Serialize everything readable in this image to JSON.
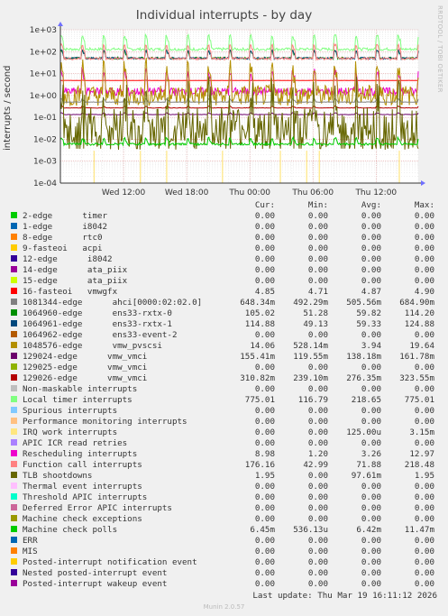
{
  "title": "Individual interrupts - by day",
  "y_axis_label": "interrupts / second",
  "side_label": "RRDTOOL / TOBI OETIKER",
  "footer": {
    "last_update": "Last update: Thu Mar 19 16:11:12 2026",
    "version": "Munin 2.0.57"
  },
  "legend_header": {
    "cur": "Cur:",
    "min": "Min:",
    "avg": "Avg:",
    "max": "Max:"
  },
  "legend": [
    {
      "label": "2-edge      timer",
      "color": "#00cc00",
      "cur": "0.00",
      "min": "0.00",
      "avg": "0.00",
      "max": "0.00"
    },
    {
      "label": "1-edge      i8042",
      "color": "#0066b3",
      "cur": "0.00",
      "min": "0.00",
      "avg": "0.00",
      "max": "0.00"
    },
    {
      "label": "8-edge      rtc0",
      "color": "#ff8000",
      "cur": "0.00",
      "min": "0.00",
      "avg": "0.00",
      "max": "0.00"
    },
    {
      "label": "9-fasteoi   acpi",
      "color": "#ffcc00",
      "cur": "0.00",
      "min": "0.00",
      "avg": "0.00",
      "max": "0.00"
    },
    {
      "label": "12-edge      i8042",
      "color": "#330099",
      "cur": "0.00",
      "min": "0.00",
      "avg": "0.00",
      "max": "0.00"
    },
    {
      "label": "14-edge      ata_piix",
      "color": "#990099",
      "cur": "0.00",
      "min": "0.00",
      "avg": "0.00",
      "max": "0.00"
    },
    {
      "label": "15-edge      ata_piix",
      "color": "#ccff00",
      "cur": "0.00",
      "min": "0.00",
      "avg": "0.00",
      "max": "0.00"
    },
    {
      "label": "16-fasteoi   vmwgfx",
      "color": "#ff0000",
      "cur": "4.85",
      "min": "4.71",
      "avg": "4.87",
      "max": "4.90"
    },
    {
      "label": "1081344-edge      ahci[0000:02:02.0]",
      "color": "#808080",
      "cur": "648.34m",
      "min": "492.29m",
      "avg": "505.56m",
      "max": "684.90m"
    },
    {
      "label": "1064960-edge      ens33-rxtx-0",
      "color": "#008f00",
      "cur": "105.02",
      "min": "51.28",
      "avg": "59.82",
      "max": "114.20"
    },
    {
      "label": "1064961-edge      ens33-rxtx-1",
      "color": "#00487d",
      "cur": "114.88",
      "min": "49.13",
      "avg": "59.33",
      "max": "124.88"
    },
    {
      "label": "1064962-edge      ens33-event-2",
      "color": "#b35a00",
      "cur": "0.00",
      "min": "0.00",
      "avg": "0.00",
      "max": "0.00"
    },
    {
      "label": "1048576-edge      vmw_pvscsi",
      "color": "#b38f00",
      "cur": "14.06",
      "min": "528.14m",
      "avg": "3.94",
      "max": "19.64"
    },
    {
      "label": "129024-edge      vmw_vmci",
      "color": "#6b006b",
      "cur": "155.41m",
      "min": "119.55m",
      "avg": "138.18m",
      "max": "161.78m"
    },
    {
      "label": "129025-edge      vmw_vmci",
      "color": "#8fb300",
      "cur": "0.00",
      "min": "0.00",
      "avg": "0.00",
      "max": "0.00"
    },
    {
      "label": "129026-edge      vmw_vmci",
      "color": "#b30000",
      "cur": "310.82m",
      "min": "239.10m",
      "avg": "276.35m",
      "max": "323.55m"
    },
    {
      "label": "Non-maskable interrupts",
      "color": "#bebebe",
      "cur": "0.00",
      "min": "0.00",
      "avg": "0.00",
      "max": "0.00"
    },
    {
      "label": "Local timer interrupts",
      "color": "#80ff80",
      "cur": "775.01",
      "min": "116.79",
      "avg": "218.65",
      "max": "775.01"
    },
    {
      "label": "Spurious interrupts",
      "color": "#80c9ff",
      "cur": "0.00",
      "min": "0.00",
      "avg": "0.00",
      "max": "0.00"
    },
    {
      "label": "Performance monitoring interrupts",
      "color": "#ffc080",
      "cur": "0.00",
      "min": "0.00",
      "avg": "0.00",
      "max": "0.00"
    },
    {
      "label": "IRQ work interrupts",
      "color": "#ffe680",
      "cur": "0.00",
      "min": "0.00",
      "avg": "125.00u",
      "max": "3.15m"
    },
    {
      "label": "APIC ICR read retries",
      "color": "#aa80ff",
      "cur": "0.00",
      "min": "0.00",
      "avg": "0.00",
      "max": "0.00"
    },
    {
      "label": "Rescheduling interrupts",
      "color": "#ee00cc",
      "cur": "8.98",
      "min": "1.20",
      "avg": "3.26",
      "max": "12.97"
    },
    {
      "label": "Function call interrupts",
      "color": "#ff8080",
      "cur": "176.16",
      "min": "42.99",
      "avg": "71.88",
      "max": "218.48"
    },
    {
      "label": "TLB shootdowns",
      "color": "#666600",
      "cur": "1.95",
      "min": "0.00",
      "avg": "97.61m",
      "max": "1.95"
    },
    {
      "label": "Thermal event interrupts",
      "color": "#ffbfff",
      "cur": "0.00",
      "min": "0.00",
      "avg": "0.00",
      "max": "0.00"
    },
    {
      "label": "Threshold APIC interrupts",
      "color": "#00ffcc",
      "cur": "0.00",
      "min": "0.00",
      "avg": "0.00",
      "max": "0.00"
    },
    {
      "label": "Deferred Error APIC interrupts",
      "color": "#cc6699",
      "cur": "0.00",
      "min": "0.00",
      "avg": "0.00",
      "max": "0.00"
    },
    {
      "label": "Machine check exceptions",
      "color": "#999900",
      "cur": "0.00",
      "min": "0.00",
      "avg": "0.00",
      "max": "0.00"
    },
    {
      "label": "Machine check polls",
      "color": "#00cc00",
      "cur": "6.45m",
      "min": "536.13u",
      "avg": "6.42m",
      "max": "11.47m"
    },
    {
      "label": "ERR",
      "color": "#0066b3",
      "cur": "0.00",
      "min": "0.00",
      "avg": "0.00",
      "max": "0.00"
    },
    {
      "label": "MIS",
      "color": "#ff8000",
      "cur": "0.00",
      "min": "0.00",
      "avg": "0.00",
      "max": "0.00"
    },
    {
      "label": "Posted-interrupt notification event",
      "color": "#ffcc00",
      "cur": "0.00",
      "min": "0.00",
      "avg": "0.00",
      "max": "0.00"
    },
    {
      "label": "Nested posted-interrupt event",
      "color": "#330099",
      "cur": "0.00",
      "min": "0.00",
      "avg": "0.00",
      "max": "0.00"
    },
    {
      "label": "Posted-interrupt wakeup event",
      "color": "#990099",
      "cur": "0.00",
      "min": "0.00",
      "avg": "0.00",
      "max": "0.00"
    }
  ],
  "chart_data": {
    "type": "line",
    "log_scale": true,
    "title": "Individual interrupts - by day",
    "ylabel": "interrupts / second",
    "ylim": [
      0.0001,
      1000
    ],
    "y_ticks": [
      "1e-04",
      "1e-03",
      "1e-02",
      "1e-01",
      "1e+00",
      "1e+01",
      "1e+02",
      "1e+03"
    ],
    "x_hours": [
      0,
      34
    ],
    "x_ticks": [
      {
        "label": "Wed 12:00",
        "hour": 6
      },
      {
        "label": "Wed 18:00",
        "hour": 12
      },
      {
        "label": "Thu 00:00",
        "hour": 18
      },
      {
        "label": "Thu 06:00",
        "hour": 24
      },
      {
        "label": "Thu 12:00",
        "hour": 30
      }
    ],
    "grid": true,
    "series": [
      {
        "name": "Local timer interrupts",
        "color": "#80ff80",
        "base": 130,
        "spike": 520,
        "period_h": 2.0,
        "noise": 0.05
      },
      {
        "name": "1064960-edge      ens33-rxtx-0",
        "color": "#008f00",
        "base": 51,
        "spike": 105,
        "period_h": 2.0,
        "noise": 0.04
      },
      {
        "name": "1064961-edge      ens33-rxtx-1",
        "color": "#00487d",
        "base": 50,
        "spike": 115,
        "period_h": 2.0,
        "noise": 0.04
      },
      {
        "name": "Function call interrupts",
        "color": "#ff8080",
        "base": 48,
        "spike": 200,
        "period_h": 2.0,
        "noise": 0.04
      },
      {
        "name": "16-fasteoi   vmwgfx",
        "color": "#ff0000",
        "base": 4.85,
        "spike": 4.9,
        "period_h": 2.0,
        "noise": 0.005
      },
      {
        "name": "Rescheduling interrupts",
        "color": "#ee00cc",
        "base": 1.5,
        "spike": 12,
        "period_h": 2.0,
        "noise": 0.12
      },
      {
        "name": "1048576-edge      vmw_pvscsi",
        "color": "#b38f00",
        "base": 1.0,
        "spike": 19,
        "period_h": 2.0,
        "noise": 0.25
      },
      {
        "name": "1081344-edge      ahci[0000:02:02.0]",
        "color": "#808080",
        "base": 0.5,
        "spike": 0.68,
        "period_h": 2.0,
        "noise": 0.01
      },
      {
        "name": "129026-edge      vmw_vmci",
        "color": "#b30000",
        "base": 0.27,
        "spike": 0.32,
        "period_h": 2.0,
        "noise": 0.01
      },
      {
        "name": "129024-edge      vmw_vmci",
        "color": "#6b006b",
        "base": 0.135,
        "spike": 0.16,
        "period_h": 2.0,
        "noise": 0.01
      },
      {
        "name": "TLB shootdowns",
        "color": "#666600",
        "base": 0.03,
        "spike": 1.0,
        "period_h": 2.0,
        "noise": 0.45
      },
      {
        "name": "Machine check polls",
        "color": "#00cc00",
        "base": 0.006,
        "spike": 0.011,
        "period_h": 2.0,
        "noise": 0.05
      }
    ]
  }
}
